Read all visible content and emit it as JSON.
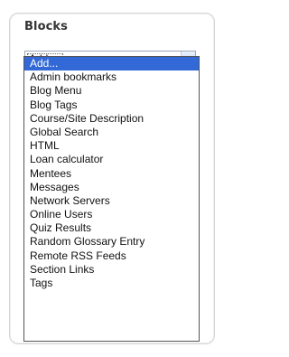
{
  "block": {
    "title": "Blocks",
    "select": {
      "selected_value": "Add...",
      "options": [
        "Add...",
        "Admin bookmarks",
        "Blog Menu",
        "Blog Tags",
        "Course/Site Description",
        "Global Search",
        "HTML",
        "Loan calculator",
        "Mentees",
        "Messages",
        "Network Servers",
        "Online Users",
        "Quiz Results",
        "Random Glossary Entry",
        "Remote RSS Feeds",
        "Section Links",
        "Tags"
      ]
    }
  },
  "icons": {
    "dropdown_arrow": "chevron-down-icon"
  },
  "colors": {
    "selected_option_bg": "#3269d6",
    "selected_option_text": "#ffffff"
  }
}
